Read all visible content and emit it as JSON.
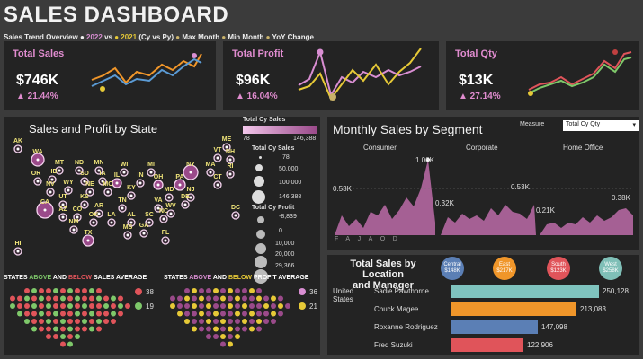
{
  "header": {
    "title": "SALES DASHBOARD",
    "legend": {
      "prefix": "Sales Trend Overview",
      "py": "2022",
      "vs": "vs",
      "cy": "2021",
      "suffix": "(Cy vs Py)",
      "max": "Max Month",
      "min": "Min Month",
      "yoy": "YoY Change"
    }
  },
  "kpis": [
    {
      "label": "Total Sales",
      "value": "$746K",
      "change": "▲ 21.44%"
    },
    {
      "label": "Total Profit",
      "value": "$96K",
      "change": "▲ 16.04%"
    },
    {
      "label": "Total Qty",
      "value": "$13K",
      "change": "▲ 27.14%"
    }
  ],
  "map": {
    "title": "Sales and Profit by State",
    "legend_sales_title": "Total Cy Sales",
    "legend_sales_min": "78",
    "legend_sales_max": "146,388",
    "legend_size_title": "Total Cy Sales",
    "legend_size_values": [
      "78",
      "50,000",
      "100,000",
      "146,388"
    ],
    "legend_profit_title": "Total Cy Profit",
    "legend_profit_values": [
      "-8,839",
      "0",
      "10,000",
      "20,000",
      "29,366"
    ],
    "states": [
      "AK",
      "ME",
      "WA",
      "MT",
      "ND",
      "MN",
      "WI",
      "MI",
      "NY",
      "VT",
      "NH",
      "OR",
      "ID",
      "SD",
      "IA",
      "IL",
      "IN",
      "OH",
      "PA",
      "CT",
      "RI",
      "NV",
      "WY",
      "NE",
      "MO",
      "KY",
      "MD",
      "NJ",
      "MA",
      "CA",
      "UT",
      "KS",
      "AR",
      "TN",
      "VA",
      "DE",
      "DC",
      "AZ",
      "CO",
      "OK",
      "LA",
      "AL",
      "SC",
      "NC",
      "WV",
      "NM",
      "TX",
      "MS",
      "GA",
      "FL",
      "HI"
    ]
  },
  "averages": {
    "sales_title_a": "STATES",
    "sales_title_above": "ABOVE",
    "sales_title_and": "AND",
    "sales_title_below": "BELOW",
    "sales_title_b": "SALES AVERAGE",
    "sales_above": "38",
    "sales_below": "19",
    "profit_title_a": "STATES",
    "profit_title_above": "ABOVE",
    "profit_title_and": "AND",
    "profit_title_below": "BELOW",
    "profit_title_b": "PROFIT AVERAGE",
    "profit_above": "36",
    "profit_below": "21"
  },
  "segments": {
    "title": "Monthly Sales by Segment",
    "measure_label": "Measure",
    "measure_value": "Total Cy Qty",
    "names": [
      "Consumer",
      "Corporate",
      "Home Office"
    ],
    "labels": [
      "1.06K",
      "0.53K",
      "0.32K",
      "0.53K",
      "0.21K",
      "0.38K"
    ],
    "months": [
      "F",
      "A",
      "J",
      "A",
      "O",
      "D"
    ]
  },
  "managers": {
    "title_line1": "Total Sales by Location",
    "title_line2": "and Manager",
    "regions": [
      {
        "name": "Central",
        "value": "$148K",
        "color": "#5b7fb5"
      },
      {
        "name": "East",
        "value": "$217K",
        "color": "#f0962a"
      },
      {
        "name": "South",
        "value": "$123K",
        "color": "#e0545a"
      },
      {
        "name": "West",
        "value": "$258K",
        "color": "#7fbfb7"
      }
    ],
    "country": "United States",
    "rows": [
      {
        "name": "Sadie Pawthorne",
        "value": "250,128",
        "num": 250128,
        "color": "#7fc3be"
      },
      {
        "name": "Chuck Magee",
        "value": "213,083",
        "num": 213083,
        "color": "#f0962a"
      },
      {
        "name": "Roxanne Rodriguez",
        "value": "147,098",
        "num": 147098,
        "color": "#5b7fb5"
      },
      {
        "name": "Fred Suzuki",
        "value": "122,906",
        "num": 122906,
        "color": "#e0545a"
      }
    ]
  },
  "colors": {
    "pink": "#e08ccf",
    "yellow": "#f0e57a",
    "panel": "#232323"
  }
}
